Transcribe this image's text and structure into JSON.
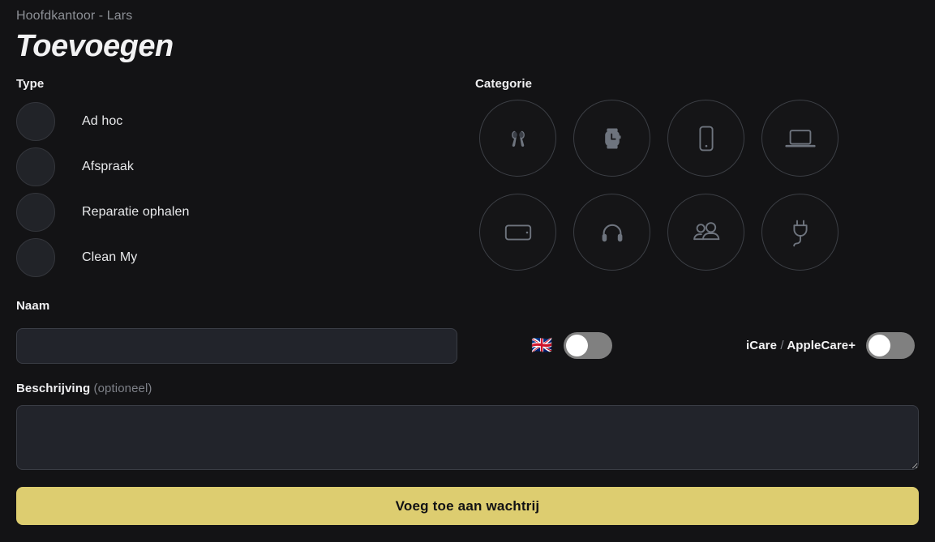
{
  "header": {
    "breadcrumb": "Hoofdkantoor - Lars",
    "title": "Toevoegen"
  },
  "type_section": {
    "label": "Type",
    "options": [
      {
        "label": "Ad hoc",
        "selected": false
      },
      {
        "label": "Afspraak",
        "selected": false
      },
      {
        "label": "Reparatie ophalen",
        "selected": false
      },
      {
        "label": "Clean My",
        "selected": false
      }
    ]
  },
  "category_section": {
    "label": "Categorie",
    "items": [
      {
        "icon": "airpods-icon",
        "selected": false
      },
      {
        "icon": "apple-watch-icon",
        "selected": false
      },
      {
        "icon": "iphone-icon",
        "selected": false
      },
      {
        "icon": "macbook-icon",
        "selected": false
      },
      {
        "icon": "ipad-icon",
        "selected": false
      },
      {
        "icon": "headphones-icon",
        "selected": false
      },
      {
        "icon": "people-icon",
        "selected": false
      },
      {
        "icon": "power-plug-icon",
        "selected": false
      }
    ]
  },
  "name_field": {
    "label": "Naam",
    "value": "",
    "placeholder": ""
  },
  "description_field": {
    "label": "Beschrijving",
    "optional_suffix": "(optioneel)",
    "value": "",
    "placeholder": ""
  },
  "toggles": {
    "language": {
      "flag": "🇬🇧",
      "icon": "uk-flag-icon",
      "state": "off"
    },
    "care": {
      "label_primary": "iCare",
      "label_separator": "/",
      "label_secondary": "AppleCare+",
      "state": "off"
    }
  },
  "submit": {
    "label": "Voeg toe aan wachtrij"
  },
  "colors": {
    "background": "#131315",
    "accent": "#ddcd70",
    "field_background": "#22242b",
    "field_border": "#3a3d45",
    "muted_text": "#8d9096",
    "icon": "#6e747e",
    "toggle_track": "#808080"
  }
}
